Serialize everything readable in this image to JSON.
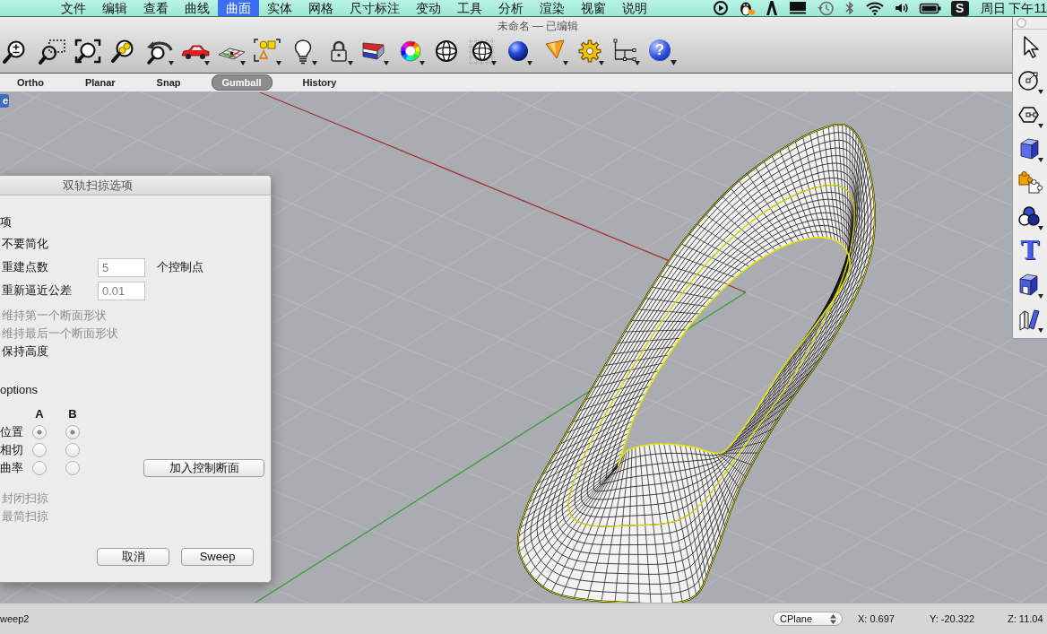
{
  "menu_bar": {
    "items": [
      {
        "label": "文件",
        "selected": false
      },
      {
        "label": "编辑",
        "selected": false
      },
      {
        "label": "查看",
        "selected": false
      },
      {
        "label": "曲线",
        "selected": false
      },
      {
        "label": "曲面",
        "selected": true
      },
      {
        "label": "实体",
        "selected": false
      },
      {
        "label": "网格",
        "selected": false
      },
      {
        "label": "尺寸标注",
        "selected": false
      },
      {
        "label": "变动",
        "selected": false
      },
      {
        "label": "工具",
        "selected": false
      },
      {
        "label": "分析",
        "selected": false
      },
      {
        "label": "渲染",
        "selected": false
      },
      {
        "label": "视窗",
        "selected": false
      },
      {
        "label": "说明",
        "selected": false
      }
    ],
    "app_badge": "S",
    "clock": "周日 下午11"
  },
  "window": {
    "title": "未命名 — 已编辑"
  },
  "toolbar": {
    "help_glyph": "?"
  },
  "mode_bar": {
    "items": [
      {
        "label": "Ortho",
        "selected": false
      },
      {
        "label": "Planar",
        "selected": false
      },
      {
        "label": "Snap",
        "selected": false
      },
      {
        "label": "Gumball",
        "selected": true
      },
      {
        "label": "History",
        "selected": false
      }
    ]
  },
  "viewport": {
    "tab": "e"
  },
  "dialog": {
    "title": "双轨扫掠选项",
    "heading": "项",
    "options": [
      {
        "kind": "text",
        "label": "不要简化",
        "disabled": false
      },
      {
        "kind": "field",
        "label": "重建点数",
        "value": "5",
        "unit": "个控制点",
        "disabled": false
      },
      {
        "kind": "field",
        "label": "重新逼近公差",
        "value": "0.01",
        "disabled": false
      },
      {
        "kind": "text",
        "label": "维持第一个断面形状",
        "disabled": true
      },
      {
        "kind": "text",
        "label": "维持最后一个断面形状",
        "disabled": true
      },
      {
        "kind": "text",
        "label": "保持高度",
        "disabled": false
      }
    ],
    "continuity": {
      "heading": "options",
      "columns": [
        "A",
        "B"
      ],
      "rows": [
        {
          "label": "位置",
          "choices": [
            {
              "selected": true
            },
            {
              "selected": true
            }
          ]
        },
        {
          "label": "相切",
          "choices": [
            {
              "selected": false
            },
            {
              "selected": false
            }
          ]
        },
        {
          "label": "曲率",
          "choices": [
            {
              "selected": false
            },
            {
              "selected": false
            }
          ]
        }
      ]
    },
    "add_button": "加入控制断面",
    "extra_options": [
      {
        "label": "封闭扫掠",
        "disabled": true
      },
      {
        "label": "最简扫掠",
        "disabled": true
      }
    ],
    "buttons": [
      {
        "label": "取消"
      },
      {
        "label": "Sweep"
      }
    ]
  },
  "right_palette": {
    "text_tool_glyph": "T"
  },
  "status_bar": {
    "command": "weep2",
    "cplane": "CPlane",
    "coordinates": [
      "X: 0.697",
      "Y: -20.322",
      "Z: 11.04"
    ]
  }
}
